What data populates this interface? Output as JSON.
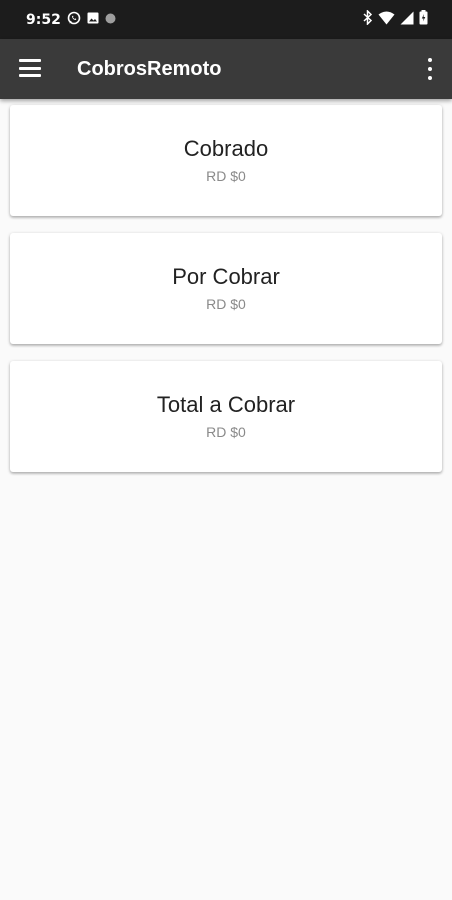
{
  "status_bar": {
    "time": "9:52",
    "left_icons": [
      "whatsapp-icon",
      "image-icon",
      "dot-icon"
    ],
    "right_icons": [
      "bluetooth-icon",
      "wifi-icon",
      "signal-icon",
      "battery-icon"
    ]
  },
  "app_bar": {
    "title": "CobrosRemoto",
    "menu_icon": "hamburger-menu-icon",
    "overflow_icon": "more-vert-icon"
  },
  "cards": [
    {
      "title": "Cobrado",
      "value": "RD $0"
    },
    {
      "title": "Por Cobrar",
      "value": "RD $0"
    },
    {
      "title": "Total a Cobrar",
      "value": "RD $0"
    }
  ],
  "colors": {
    "status_bar": "#1c1c1c",
    "app_bar": "#3a3a3a",
    "background": "#fafafa",
    "card": "#ffffff"
  }
}
